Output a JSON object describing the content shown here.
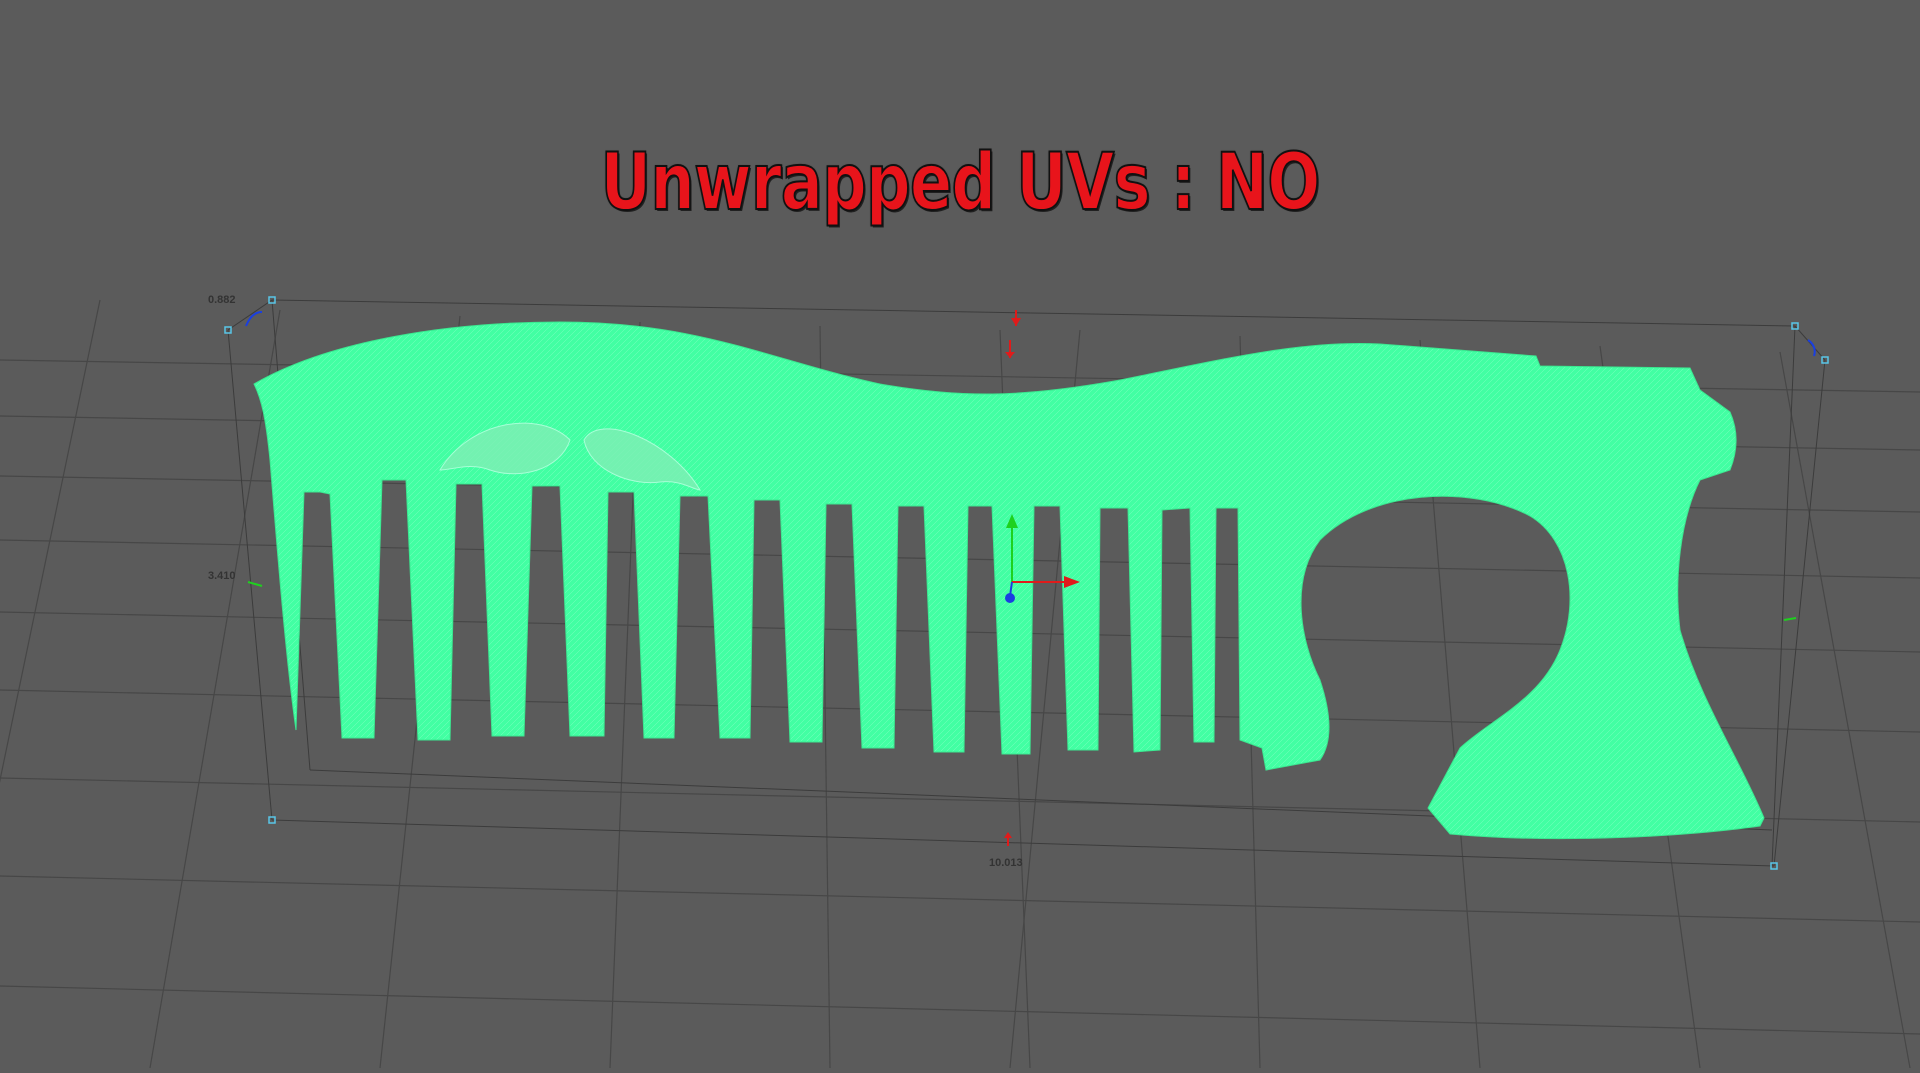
{
  "viewport": {
    "overlay_title": "Unwrapped UVs : NO",
    "object": "comb-mesh",
    "dimensions": {
      "height": "0.882",
      "depth": "3.410",
      "width": "10.013"
    }
  },
  "colors": {
    "background": "#5b5b5b",
    "grid": "#4a4a4a",
    "mesh": "#42ffa3",
    "title": "#e8141b",
    "axis_x": "#e01b1b",
    "axis_y": "#1ed11e",
    "axis_z": "#1a3fe0",
    "bbox_handle": "#59c6e8"
  },
  "icons": [
    "rotate-handle-icon",
    "scale-handle-icon",
    "move-gizmo-icon"
  ]
}
